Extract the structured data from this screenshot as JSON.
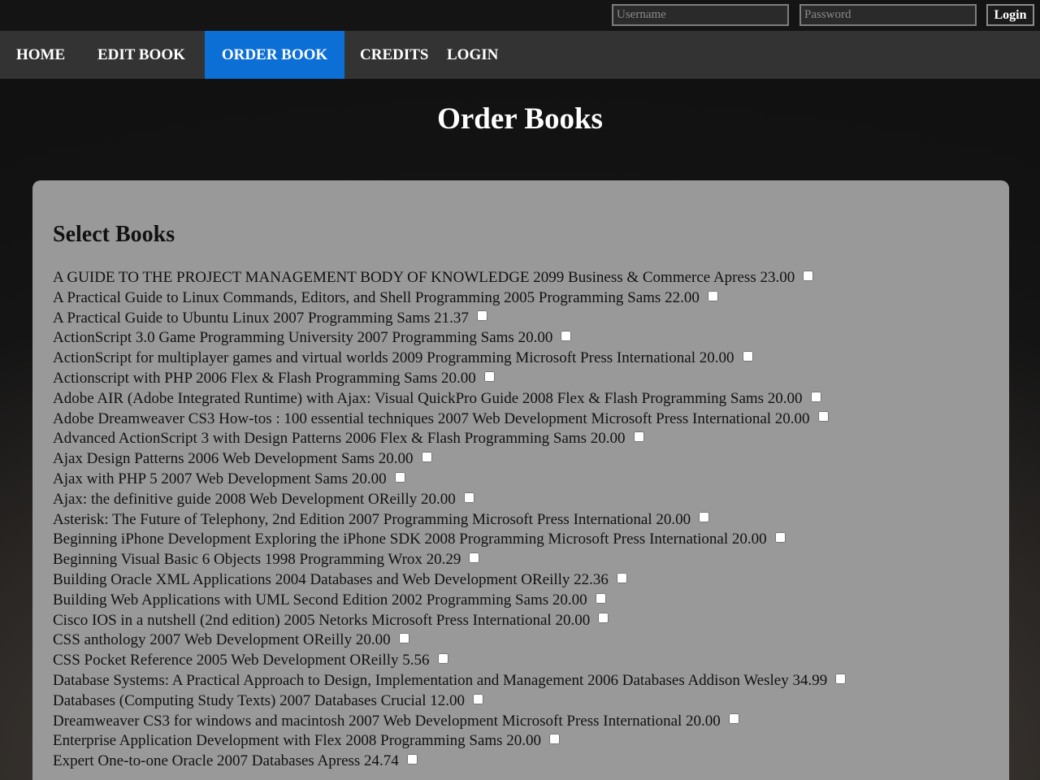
{
  "topbar": {
    "username_placeholder": "Username",
    "password_placeholder": "Password",
    "login_label": "Login"
  },
  "nav": {
    "items": [
      "HOME",
      "EDIT BOOK",
      "ORDER BOOK",
      "CREDITS",
      "LOGIN"
    ],
    "active": "ORDER BOOK",
    "active_color": "#0b6fd6"
  },
  "page": {
    "title": "Order Books"
  },
  "panel": {
    "heading": "Select Books",
    "books": [
      "A GUIDE TO THE PROJECT MANAGEMENT BODY OF KNOWLEDGE 2099 Business & Commerce Apress 23.00",
      "A Practical Guide to Linux Commands, Editors, and Shell Programming 2005 Programming Sams 22.00",
      "A Practical Guide to Ubuntu Linux 2007 Programming Sams 21.37",
      "ActionScript 3.0 Game Programming University 2007 Programming Sams 20.00",
      "ActionScript for multiplayer games and virtual worlds 2009 Programming Microsoft Press International 20.00",
      "Actionscript with PHP 2006 Flex & Flash Programming Sams 20.00",
      "Adobe AIR (Adobe Integrated Runtime) with Ajax: Visual QuickPro Guide 2008 Flex & Flash Programming Sams 20.00",
      "Adobe Dreamweaver CS3 How-tos : 100 essential techniques 2007 Web Development Microsoft Press International 20.00",
      "Advanced ActionScript 3 with Design Patterns 2006 Flex & Flash Programming Sams 20.00",
      "Ajax Design Patterns 2006 Web Development Sams 20.00",
      "Ajax with PHP 5 2007 Web Development Sams 20.00",
      "Ajax: the definitive guide 2008 Web Development OReilly 20.00",
      "Asterisk: The Future of Telephony, 2nd Edition 2007 Programming Microsoft Press International 20.00",
      "Beginning iPhone Development Exploring the iPhone SDK 2008 Programming Microsoft Press International 20.00",
      "Beginning Visual Basic 6 Objects 1998 Programming Wrox 20.29",
      "Building Oracle XML Applications 2004 Databases and Web Development OReilly 22.36",
      "Building Web Applications with UML Second Edition 2002 Programming Sams 20.00",
      "Cisco IOS in a nutshell (2nd edition) 2005 Netorks Microsoft Press International 20.00",
      "CSS anthology 2007 Web Development OReilly 20.00",
      "CSS Pocket Reference 2005 Web Development OReilly 5.56",
      "Database Systems: A Practical Approach to Design, Implementation and Management 2006 Databases Addison Wesley 34.99",
      "Databases (Computing Study Texts) 2007 Databases Crucial 12.00",
      "Dreamweaver CS3 for windows and macintosh 2007 Web Development Microsoft Press International 20.00",
      "Enterprise Application Development with Flex 2008 Programming Sams 20.00",
      "Expert One-to-one Oracle 2007 Databases Apress 24.74"
    ]
  }
}
